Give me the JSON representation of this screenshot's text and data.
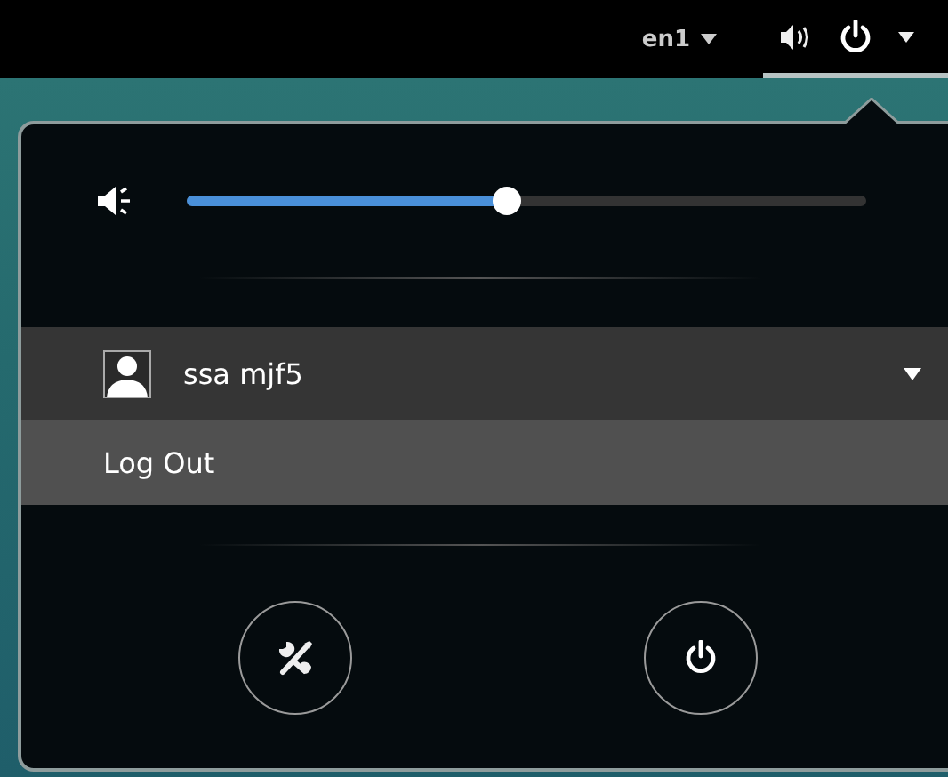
{
  "top_bar": {
    "keyboard_layout": "en1"
  },
  "volume": {
    "level": 0.47
  },
  "user_menu": {
    "name": "ssa mjf5",
    "expanded": true,
    "items": [
      {
        "label": "Log Out",
        "selected": true
      }
    ]
  }
}
